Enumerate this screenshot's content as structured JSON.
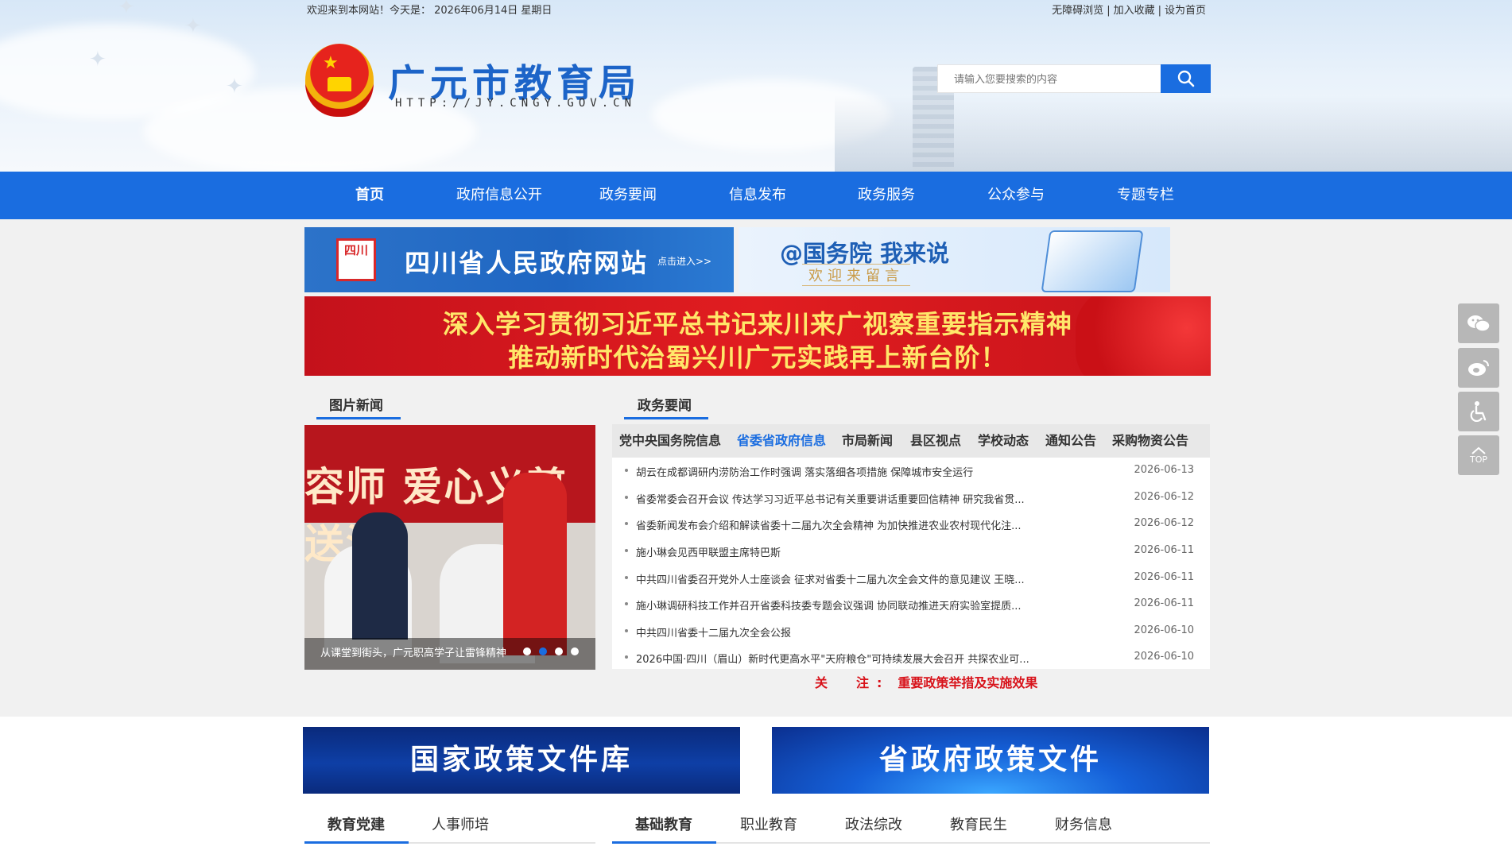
{
  "topbar": {
    "welcome": "欢迎来到本网站！今天是：  2026年06月14日 星期日",
    "links": [
      "无障碍浏览",
      "加入收藏",
      "设为首页"
    ],
    "separator": "|"
  },
  "site": {
    "title": "广元市教育局",
    "url": "HTTP://JY.CNGY.GOV.CN"
  },
  "search": {
    "placeholder": "请输入您要搜索的内容",
    "icon": "search-icon"
  },
  "nav": {
    "items": [
      "首页",
      "政府信息公开",
      "政务要闻",
      "信息发布",
      "政务服务",
      "公众参与",
      "专题专栏"
    ],
    "active_index": 0
  },
  "banners": {
    "sichuan": {
      "seal": "四川",
      "title": "四川省人民政府网站",
      "sub": "点击进入>>"
    },
    "guowuyuan": {
      "title": "@国务院 我来说",
      "sub": "欢迎来留言"
    },
    "red_line1": "深入学习贯彻习近平总书记来川来广视察重要指示精神",
    "red_line2": "推动新时代治蜀兴川广元实践再上新台阶！"
  },
  "photo_news": {
    "title": "图片新闻",
    "caption": "从课堂到街头，广元职高学子让雷锋精神",
    "image_text": "容师 爱心义剪送温",
    "active_dot": 1
  },
  "zhengwu": {
    "title": "政务要闻",
    "tabs": [
      "党中央国务院信息",
      "省委省政府信息",
      "市局新闻",
      "县区视点",
      "学校动态",
      "通知公告",
      "采购物资公告"
    ],
    "active_tab": 1,
    "news": [
      {
        "title": "胡云在成都调研内涝防治工作时强调 落实落细各项措施 保障城市安全运行",
        "date": "2026-06-13"
      },
      {
        "title": "省委常委会召开会议 传达学习习近平总书记有关重要讲话重要回信精神 研究我省贯...",
        "date": "2026-06-12"
      },
      {
        "title": "省委新闻发布会介绍和解读省委十二届九次全会精神 为加快推进农业农村现代化注...",
        "date": "2026-06-12"
      },
      {
        "title": "施小琳会见西甲联盟主席特巴斯",
        "date": "2026-06-11"
      },
      {
        "title": "中共四川省委召开党外人士座谈会 征求对省委十二届九次全会文件的意见建议 王晓...",
        "date": "2026-06-11"
      },
      {
        "title": "施小琳调研科技工作并召开省委科技委专题会议强调 协同联动推进天府实验室提质...",
        "date": "2026-06-11"
      },
      {
        "title": "中共四川省委十二届九次全会公报",
        "date": "2026-06-10"
      },
      {
        "title": "2026中国·四川（眉山）新时代更高水平\"天府粮仓\"可持续发展大会召开 共探农业可...",
        "date": "2026-06-10"
      }
    ]
  },
  "focus": {
    "label": "关　注:",
    "text": "重要政策举措及实施效果"
  },
  "policy": {
    "national": "国家政策文件库",
    "provincial": "省政府政策文件"
  },
  "bottom_tabs_left": [
    "教育党建",
    "人事师培"
  ],
  "bottom_tabs_right": [
    "基础教育",
    "职业教育",
    "政法综改",
    "教育民生",
    "财务信息"
  ],
  "side_tools": {
    "icons": [
      "wechat-icon",
      "weibo-icon",
      "accessibility-icon",
      "back-to-top-icon"
    ],
    "top_label": "TOP"
  },
  "colors": {
    "primary": "#1a6de0",
    "accent_red": "#d8121a",
    "banner_gold": "#ffe76a"
  }
}
